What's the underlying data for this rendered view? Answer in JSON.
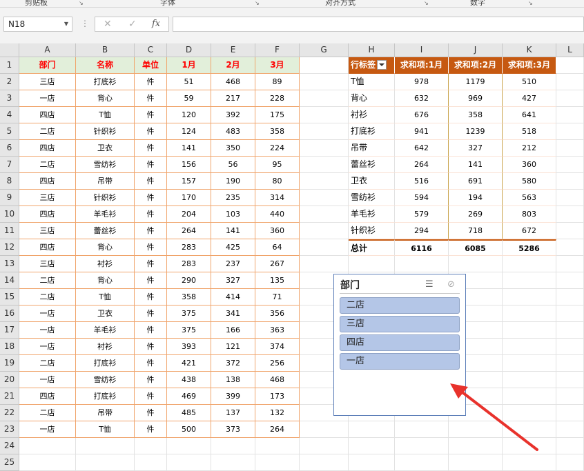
{
  "ribbon": {
    "groups": [
      "剪贴板",
      "字体",
      "对齐方式",
      "数字"
    ]
  },
  "formula_bar": {
    "name_box": "N18",
    "cancel_icon": "✕",
    "enter_icon": "✓",
    "fx_label": "fx",
    "formula": ""
  },
  "columns": [
    "A",
    "B",
    "C",
    "D",
    "E",
    "F",
    "G",
    "H",
    "I",
    "J",
    "K",
    "L"
  ],
  "rows": [
    "1",
    "2",
    "3",
    "4",
    "5",
    "6",
    "7",
    "8",
    "9",
    "10",
    "11",
    "12",
    "13",
    "14",
    "15",
    "16",
    "17",
    "18",
    "19",
    "20",
    "21",
    "22",
    "23",
    "24",
    "25"
  ],
  "source_table": {
    "headers": [
      "部门",
      "名称",
      "单位",
      "1月",
      "2月",
      "3月"
    ],
    "rows": [
      [
        "三店",
        "打底衫",
        "件",
        "51",
        "468",
        "89"
      ],
      [
        "一店",
        "背心",
        "件",
        "59",
        "217",
        "228"
      ],
      [
        "四店",
        "T恤",
        "件",
        "120",
        "392",
        "175"
      ],
      [
        "二店",
        "针织衫",
        "件",
        "124",
        "483",
        "358"
      ],
      [
        "四店",
        "卫衣",
        "件",
        "141",
        "350",
        "224"
      ],
      [
        "二店",
        "雪纺衫",
        "件",
        "156",
        "56",
        "95"
      ],
      [
        "四店",
        "吊带",
        "件",
        "157",
        "190",
        "80"
      ],
      [
        "三店",
        "针织衫",
        "件",
        "170",
        "235",
        "314"
      ],
      [
        "四店",
        "羊毛衫",
        "件",
        "204",
        "103",
        "440"
      ],
      [
        "三店",
        "蕾丝衫",
        "件",
        "264",
        "141",
        "360"
      ],
      [
        "四店",
        "背心",
        "件",
        "283",
        "425",
        "64"
      ],
      [
        "三店",
        "衬衫",
        "件",
        "283",
        "237",
        "267"
      ],
      [
        "二店",
        "背心",
        "件",
        "290",
        "327",
        "135"
      ],
      [
        "二店",
        "T恤",
        "件",
        "358",
        "414",
        "71"
      ],
      [
        "一店",
        "卫衣",
        "件",
        "375",
        "341",
        "356"
      ],
      [
        "一店",
        "羊毛衫",
        "件",
        "375",
        "166",
        "363"
      ],
      [
        "一店",
        "衬衫",
        "件",
        "393",
        "121",
        "374"
      ],
      [
        "二店",
        "打底衫",
        "件",
        "421",
        "372",
        "256"
      ],
      [
        "一店",
        "雪纺衫",
        "件",
        "438",
        "138",
        "468"
      ],
      [
        "四店",
        "打底衫",
        "件",
        "469",
        "399",
        "173"
      ],
      [
        "二店",
        "吊带",
        "件",
        "485",
        "137",
        "132"
      ],
      [
        "一店",
        "T恤",
        "件",
        "500",
        "373",
        "264"
      ]
    ]
  },
  "pivot": {
    "headers": [
      "行标签",
      "求和项:1月",
      "求和项:2月",
      "求和项:3月"
    ],
    "rows": [
      [
        "T恤",
        "978",
        "1179",
        "510"
      ],
      [
        "背心",
        "632",
        "969",
        "427"
      ],
      [
        "衬衫",
        "676",
        "358",
        "641"
      ],
      [
        "打底衫",
        "941",
        "1239",
        "518"
      ],
      [
        "吊带",
        "642",
        "327",
        "212"
      ],
      [
        "蕾丝衫",
        "264",
        "141",
        "360"
      ],
      [
        "卫衣",
        "516",
        "691",
        "580"
      ],
      [
        "雪纺衫",
        "594",
        "194",
        "563"
      ],
      [
        "羊毛衫",
        "579",
        "269",
        "803"
      ],
      [
        "针织衫",
        "294",
        "718",
        "672"
      ]
    ],
    "total": [
      "总计",
      "6116",
      "6085",
      "5286"
    ]
  },
  "slicer": {
    "title": "部门",
    "items": [
      "二店",
      "三店",
      "四店",
      "一店"
    ],
    "multiselect_icon": "☰",
    "clear_filter_icon": "⊘"
  },
  "colors": {
    "pivot_header": "#c65911",
    "source_header_bg": "#e2efda",
    "source_header_text": "#ff0000",
    "slicer_item": "#b4c6e7",
    "arrow": "#e8322c"
  }
}
